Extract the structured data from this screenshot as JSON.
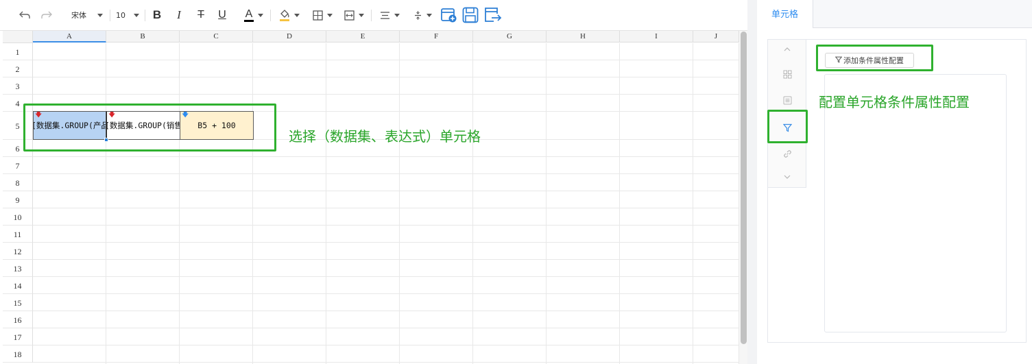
{
  "toolbar": {
    "font_name": "宋体",
    "font_size": "10",
    "bold_label": "B",
    "italic_label": "I",
    "strike_label": "T",
    "underline_label": "U",
    "font_color_label": "A",
    "icons": [
      "undo-icon",
      "redo-icon",
      "paint-bucket-icon",
      "border-icon",
      "merge-cells-icon",
      "align-icon",
      "vertical-align-icon",
      "new-sheet-icon",
      "save-icon",
      "export-icon"
    ]
  },
  "sheet": {
    "columns": [
      "A",
      "B",
      "C",
      "D",
      "E",
      "F",
      "G",
      "H",
      "I",
      "J"
    ],
    "rows": [
      "1",
      "2",
      "3",
      "4",
      "5",
      "6",
      "7",
      "8",
      "9",
      "10",
      "11",
      "12",
      "13",
      "14",
      "15",
      "16",
      "17",
      "18"
    ],
    "selected_column": "A",
    "cells": {
      "A5": "[数据集.GROUP(产品",
      "B5": "[数据集.GROUP(销售",
      "C5": "B5 + 100"
    },
    "arrow_colors": {
      "A5": "#d9262c",
      "B5": "#d9262c",
      "C5": "#2d8cf0"
    }
  },
  "annotations": {
    "cells_note": "选择（数据集、表达式）单元格",
    "panel_note": "配置单元格条件属性配置",
    "color": "#2fb12f"
  },
  "panel": {
    "active_tab": "单元格",
    "add_button_label": "添加条件属性配置",
    "side_icons": [
      "chevron-up-icon",
      "grid-icon",
      "list-icon",
      "filter-icon",
      "link-icon",
      "chevron-down-icon"
    ],
    "active_side_icon": "filter-icon"
  }
}
